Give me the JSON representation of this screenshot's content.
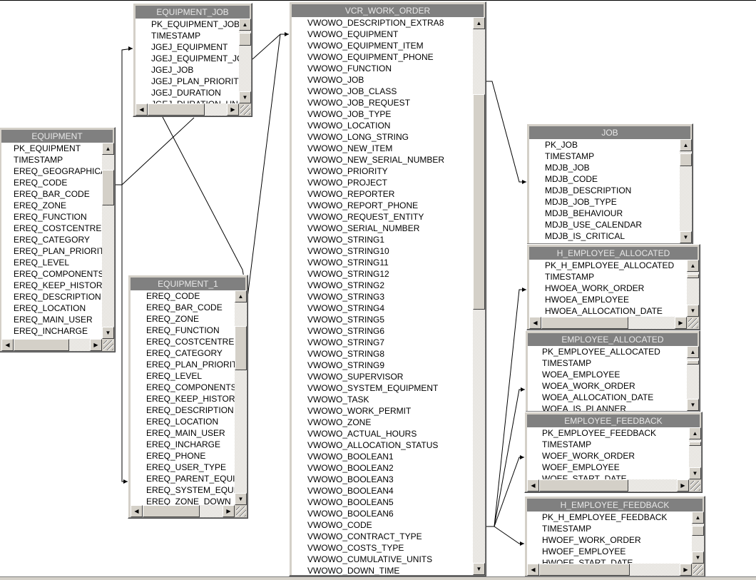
{
  "tables": [
    {
      "id": "equipment_job",
      "title": "EQUIPMENT_JOB",
      "rows": [
        "PK_EQUIPMENT_JOB",
        "TIMESTAMP",
        "JGEJ_EQUIPMENT",
        "JGEJ_EQUIPMENT_JO",
        "JGEJ_JOB",
        "JGEJ_PLAN_PRIORITY",
        "JGEJ_DURATION",
        "JGEJ_DURATION_UN"
      ]
    },
    {
      "id": "vcr_work_order",
      "title": "VCR_WORK_ORDER",
      "rows": [
        "VWOWO_DESCRIPTION_EXTRA8",
        "VWOWO_EQUIPMENT",
        "VWOWO_EQUIPMENT_ITEM",
        "VWOWO_EQUIPMENT_PHONE",
        "VWOWO_FUNCTION",
        "VWOWO_JOB",
        "VWOWO_JOB_CLASS",
        "VWOWO_JOB_REQUEST",
        "VWOWO_JOB_TYPE",
        "VWOWO_LOCATION",
        "VWOWO_LONG_STRING",
        "VWOWO_NEW_ITEM",
        "VWOWO_NEW_SERIAL_NUMBER",
        "VWOWO_PRIORITY",
        "VWOWO_PROJECT",
        "VWOWO_REPORTER",
        "VWOWO_REPORT_PHONE",
        "VWOWO_REQUEST_ENTITY",
        "VWOWO_SERIAL_NUMBER",
        "VWOWO_STRING1",
        "VWOWO_STRING10",
        "VWOWO_STRING11",
        "VWOWO_STRING12",
        "VWOWO_STRING2",
        "VWOWO_STRING3",
        "VWOWO_STRING4",
        "VWOWO_STRING5",
        "VWOWO_STRING6",
        "VWOWO_STRING7",
        "VWOWO_STRING8",
        "VWOWO_STRING9",
        "VWOWO_SUPERVISOR",
        "VWOWO_SYSTEM_EQUIPMENT",
        "VWOWO_TASK",
        "VWOWO_WORK_PERMIT",
        "VWOWO_ZONE",
        "VWOWO_ACTUAL_HOURS",
        "VWOWO_ALLOCATION_STATUS",
        "VWOWO_BOOLEAN1",
        "VWOWO_BOOLEAN2",
        "VWOWO_BOOLEAN3",
        "VWOWO_BOOLEAN4",
        "VWOWO_BOOLEAN5",
        "VWOWO_BOOLEAN6",
        "VWOWO_CODE",
        "VWOWO_CONTRACT_TYPE",
        "VWOWO_COSTS_TYPE",
        "VWOWO_CUMULATIVE_UNITS",
        "VWOWO_DOWN_TIME"
      ]
    },
    {
      "id": "equipment",
      "title": "EQUIPMENT",
      "rows": [
        "PK_EQUIPMENT",
        "TIMESTAMP",
        "EREQ_GEOGRAPHICA",
        "EREQ_CODE",
        "EREQ_BAR_CODE",
        "EREQ_ZONE",
        "EREQ_FUNCTION",
        "EREQ_COSTCENTRE",
        "EREQ_CATEGORY",
        "EREQ_PLAN_PRIORIT",
        "EREQ_LEVEL",
        "EREQ_COMPONENTS",
        "EREQ_KEEP_HISTOR",
        "EREQ_DESCRIPTION",
        "EREQ_LOCATION",
        "EREQ_MAIN_USER",
        "EREQ_INCHARGE"
      ]
    },
    {
      "id": "equipment_1",
      "title": "EQUIPMENT_1",
      "rows": [
        "EREQ_CODE",
        "EREQ_BAR_CODE",
        "EREQ_ZONE",
        "EREQ_FUNCTION",
        "EREQ_COSTCENTRE",
        "EREQ_CATEGORY",
        "EREQ_PLAN_PRIORIT",
        "EREQ_LEVEL",
        "EREQ_COMPONENTS",
        "EREQ_KEEP_HISTOR",
        "EREQ_DESCRIPTION",
        "EREQ_LOCATION",
        "EREQ_MAIN_USER",
        "EREQ_INCHARGE",
        "EREQ_PHONE",
        "EREQ_USER_TYPE",
        "EREQ_PARENT_EQUI",
        "EREQ_SYSTEM_EQUI",
        "EREQ_ZONE_DOWN"
      ]
    },
    {
      "id": "job",
      "title": "JOB",
      "rows": [
        "PK_JOB",
        "TIMESTAMP",
        "MDJB_JOB",
        "MDJB_CODE",
        "MDJB_DESCRIPTION",
        "MDJB_JOB_TYPE",
        "MDJB_BEHAVIOUR",
        "MDJB_USE_CALENDAR",
        "MDJB_IS_CRITICAL"
      ]
    },
    {
      "id": "h_employee_allocated",
      "title": "H_EMPLOYEE_ALLOCATED",
      "rows": [
        "PK_H_EMPLOYEE_ALLOCATED",
        "TIMESTAMP",
        "HWOEA_WORK_ORDER",
        "HWOEA_EMPLOYEE",
        "HWOEA_ALLOCATION_DATE"
      ]
    },
    {
      "id": "employee_allocated",
      "title": "EMPLOYEE_ALLOCATED",
      "rows": [
        "PK_EMPLOYEE_ALLOCATED",
        "TIMESTAMP",
        "WOEA_EMPLOYEE",
        "WOEA_WORK_ORDER",
        "WOEA_ALLOCATION_DATE",
        "WOEA_IS_PLANNER"
      ]
    },
    {
      "id": "employee_feedback",
      "title": "EMPLOYEE_FEEDBACK",
      "rows": [
        "PK_EMPLOYEE_FEEDBACK",
        "TIMESTAMP",
        "WOEF_WORK_ORDER",
        "WOEF_EMPLOYEE",
        "WOEF_START_DATE"
      ]
    },
    {
      "id": "h_employee_feedback",
      "title": "H_EMPLOYEE_FEEDBACK",
      "rows": [
        "PK_H_EMPLOYEE_FEEDBACK",
        "TIMESTAMP",
        "HWOEF_WORK_ORDER",
        "HWOEF_EMPLOYEE",
        "HWOEF_START_DATE"
      ]
    }
  ],
  "colors": {
    "title_bar": "#808080",
    "title_text": "#e8e8e8",
    "window_face": "#d4d0c8",
    "connector": "#000000"
  }
}
